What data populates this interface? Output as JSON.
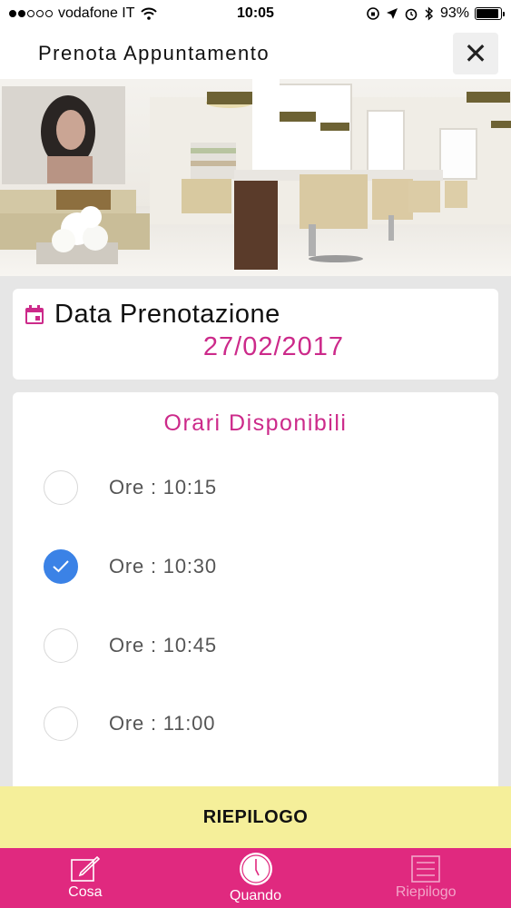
{
  "status_bar": {
    "carrier": "vodafone IT",
    "time": "10:05",
    "battery": "93%",
    "battery_level": 0.93,
    "signal_bars_on": 2,
    "signal_bars_total": 5
  },
  "header": {
    "title": "Prenota Appuntamento",
    "close_icon": "close-icon"
  },
  "date_section": {
    "label": "Data Prenotazione",
    "value": "27/02/2017",
    "icon": "calendar-icon"
  },
  "slots_section": {
    "title": "Orari Disponibili",
    "slots": [
      {
        "label": "Ore : 10:15",
        "selected": false
      },
      {
        "label": "Ore : 10:30",
        "selected": true
      },
      {
        "label": "Ore : 10:45",
        "selected": false
      },
      {
        "label": "Ore : 11:00",
        "selected": false
      }
    ]
  },
  "summary_button": {
    "label": "RIEPILOGO"
  },
  "tab_bar": {
    "tabs": [
      {
        "label": "Cosa",
        "icon": "edit-icon",
        "active": true
      },
      {
        "label": "Quando",
        "icon": "clock-icon",
        "active": true
      },
      {
        "label": "Riepilogo",
        "icon": "list-icon",
        "active": false
      }
    ]
  },
  "colors": {
    "accent": "#cc2a8a",
    "tab_bar": "#e0297f",
    "summary_bar": "#f5ef9a",
    "selected_radio": "#3b82e6"
  }
}
